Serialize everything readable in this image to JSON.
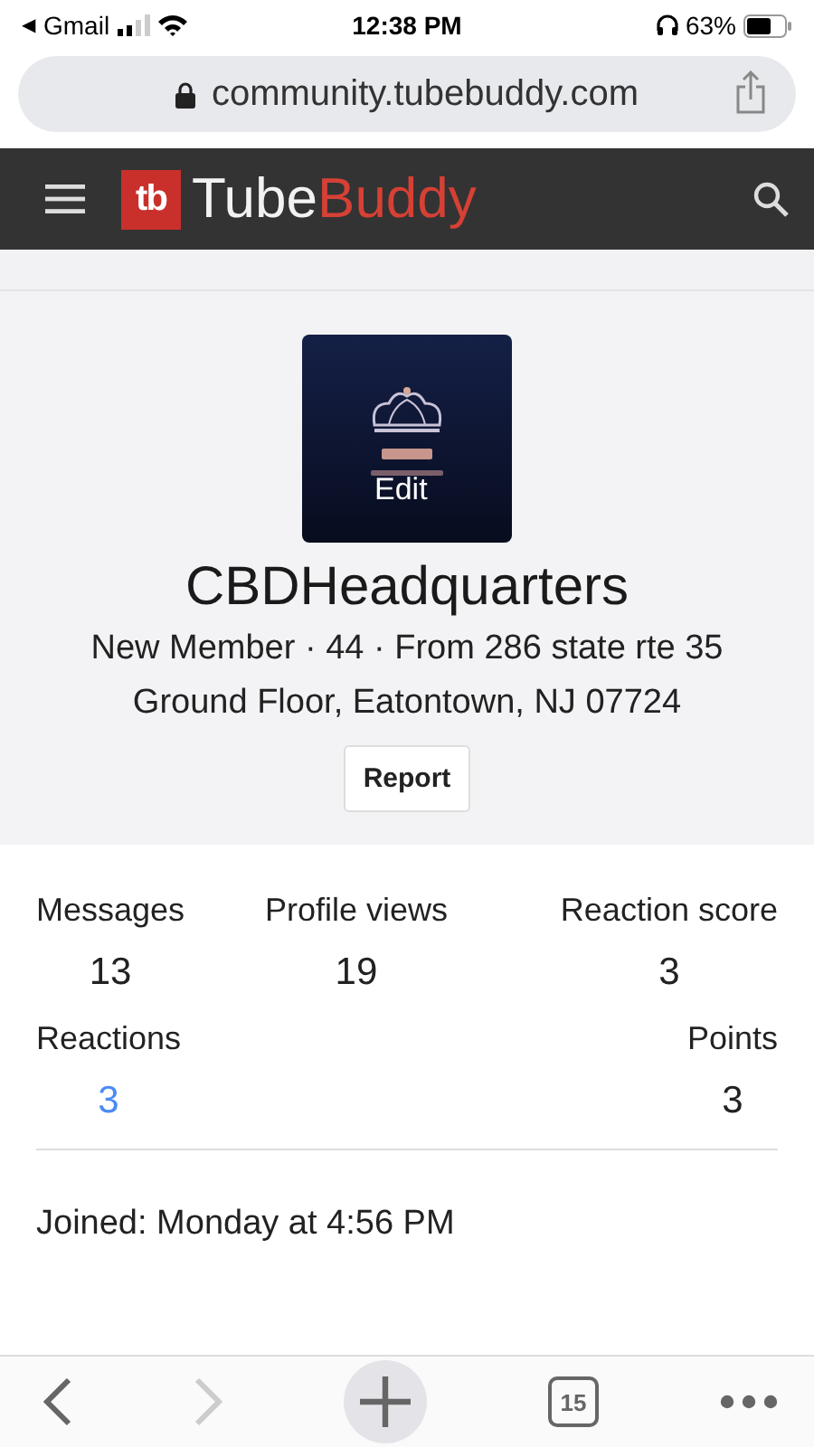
{
  "status_bar": {
    "back_glyph": "◀",
    "back_app": "Gmail",
    "time": "12:38 PM",
    "battery": "63%"
  },
  "address_bar": {
    "url": "community.tubebuddy.com"
  },
  "site_header": {
    "logo_mark": "tb",
    "logo_first": "Tube",
    "logo_second": "Buddy"
  },
  "profile": {
    "avatar": {
      "kind": "picture",
      "overlay": "Edit"
    },
    "name": "CBDHeadquarters",
    "info_lines": [
      "New Member · 44 · From 286 state rte 35",
      "Ground Floor, Eatontown, NJ 07724"
    ],
    "report_button": "Report"
  },
  "stats_rows": [
    [
      {
        "label": "Messages",
        "value": "13",
        "link": false
      },
      {
        "label": "Profile views",
        "value": "19",
        "link": false
      },
      {
        "label": "Reaction score",
        "value": "3",
        "link": false
      }
    ],
    [
      {
        "label": "Reactions",
        "value": "3",
        "link": true
      },
      {
        "label": "Points",
        "value": "3",
        "link": false
      }
    ]
  ],
  "joined": "Joined: Monday at 4:56 PM",
  "toolbar": {
    "tab_count": "15"
  }
}
